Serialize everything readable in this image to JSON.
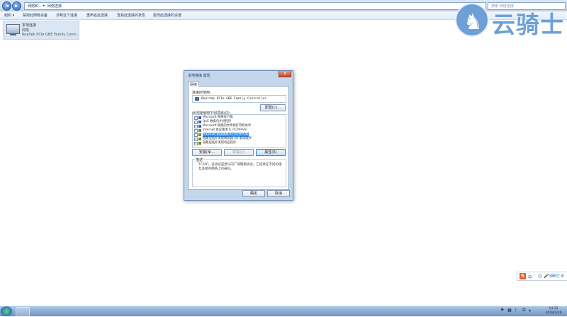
{
  "address_bar": {
    "back": "◄",
    "forward": "►",
    "breadcrumb": [
      "网络和...",
      "网络连接"
    ],
    "search_placeholder": "搜索 网络连接"
  },
  "toolbar": {
    "items": [
      "组织 ▾",
      "禁用此网络设备",
      "诊断这个连接",
      "重命名此连接",
      "查看此连接的状态",
      "更改此连接的设置"
    ]
  },
  "adapter": {
    "name": "本地连接",
    "status": "网络",
    "device": "Realtek PCIe GBE Family Contr..."
  },
  "logo": {
    "text": "云骑士",
    "icon": "knight-on-horse-icon"
  },
  "dialog": {
    "title": "本地连接 属性",
    "close_glyph": "x",
    "tab": "网络",
    "connect_using_label": "连接时使用:",
    "adapter_name": "Realtek PCIe GBE Family Controller",
    "configure_button": "配置(C)...",
    "items_label": "此连接使用下列项目(O):",
    "items": [
      {
        "text": "Microsoft 网络客户端",
        "checked": true
      },
      {
        "text": "QoS 数据包计划程序",
        "checked": true
      },
      {
        "text": "Microsoft 网络的文件和打印机共享",
        "checked": true
      },
      {
        "text": "Internet 协议版本 6 (TCP/IPv6)",
        "checked": true
      },
      {
        "text": "Internet 协议版本 4 (TCP/IPv4)",
        "checked": true,
        "selected": true
      },
      {
        "text": "链路层拓扑发现映射器 I/O 驱动程序",
        "checked": true
      },
      {
        "text": "链路层拓扑发现响应程序",
        "checked": true
      }
    ],
    "install_button": "安装(N)...",
    "uninstall_button": "卸载(U)",
    "properties_button": "属性(R)",
    "description_label": "描述",
    "description_text": "TCP/IP。该协议是默认的广域网络协议，它提供在不同的相互连接的网络上的通讯。",
    "ok_button": "确定",
    "cancel_button": "取消"
  },
  "ime_bar": {
    "logo": "S",
    "glyphs": [
      "中",
      "·",
      "☺",
      "🎤",
      "⌨",
      "👕",
      "⚙"
    ]
  },
  "taskbar": {
    "clock_time": "14:32",
    "clock_date": "2019/1/26"
  }
}
